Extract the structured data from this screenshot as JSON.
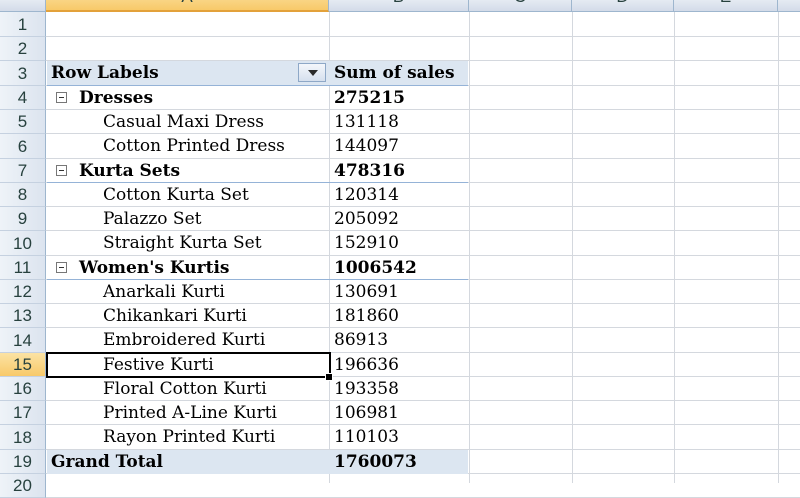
{
  "columns": [
    {
      "letter": "A"
    },
    {
      "letter": "B"
    },
    {
      "letter": "C"
    },
    {
      "letter": "D"
    },
    {
      "letter": "E"
    }
  ],
  "row_numbers": [
    "1",
    "2",
    "3",
    "4",
    "5",
    "6",
    "7",
    "8",
    "9",
    "10",
    "11",
    "12",
    "13",
    "14",
    "15",
    "16",
    "17",
    "18",
    "19",
    "20"
  ],
  "pivot": {
    "header_row_labels": "Row Labels",
    "header_values": "Sum of sales",
    "groups": [
      {
        "name": "Dresses",
        "total": "275215",
        "items": [
          {
            "label": "Casual Maxi Dress",
            "value": "131118"
          },
          {
            "label": "Cotton Printed Dress",
            "value": "144097"
          }
        ]
      },
      {
        "name": "Kurta Sets",
        "total": "478316",
        "items": [
          {
            "label": "Cotton Kurta Set",
            "value": "120314"
          },
          {
            "label": "Palazzo Set",
            "value": "205092"
          },
          {
            "label": "Straight Kurta Set",
            "value": "152910"
          }
        ]
      },
      {
        "name": "Women's Kurtis",
        "total": "1006542",
        "items": [
          {
            "label": "Anarkali Kurti",
            "value": "130691"
          },
          {
            "label": "Chikankari Kurti",
            "value": "181860"
          },
          {
            "label": "Embroidered Kurti",
            "value": "86913"
          },
          {
            "label": "Festive Kurti",
            "value": "196636"
          },
          {
            "label": "Floral Cotton Kurti",
            "value": "193358"
          },
          {
            "label": "Printed A-Line Kurti",
            "value": "106981"
          },
          {
            "label": "Rayon Printed Kurti",
            "value": "110103"
          }
        ]
      }
    ],
    "grand_total_label": "Grand Total",
    "grand_total_value": "1760073"
  },
  "selection": {
    "column": "A",
    "row": "15"
  },
  "colors": {
    "pivot_band": "#dce6f1",
    "header_selected": "#f8c969",
    "gridline": "#d4d8de"
  }
}
